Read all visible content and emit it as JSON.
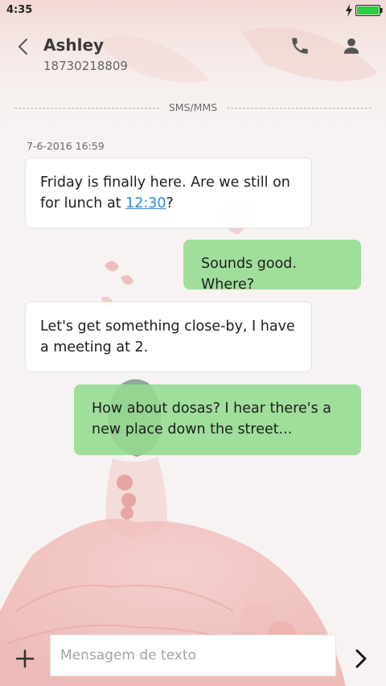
{
  "status_bar": {
    "time": "4:35"
  },
  "header": {
    "contact_name": "Ashley",
    "contact_number": "18730218809"
  },
  "thread": {
    "channel_label": "SMS/MMS",
    "timestamp": "7-6-2016 16:59",
    "messages": [
      {
        "direction": "incoming",
        "text_before_link": "Friday is finally here. Are we still on for lunch at ",
        "link": "12:30",
        "text_after_link": "?"
      },
      {
        "direction": "outgoing",
        "text": "Sounds good. Where?"
      },
      {
        "direction": "incoming",
        "text": "Let's get something close-by, I have a meeting at 2."
      },
      {
        "direction": "outgoing",
        "text": "How about dosas? I hear there's a new place down the street..."
      }
    ]
  },
  "composer": {
    "placeholder": "Mensagem de texto",
    "value": ""
  },
  "colors": {
    "outgoing_bubble": "#94db8f",
    "incoming_bubble": "#ffffff",
    "link": "#2a8be2",
    "battery": "#2ecc40"
  }
}
